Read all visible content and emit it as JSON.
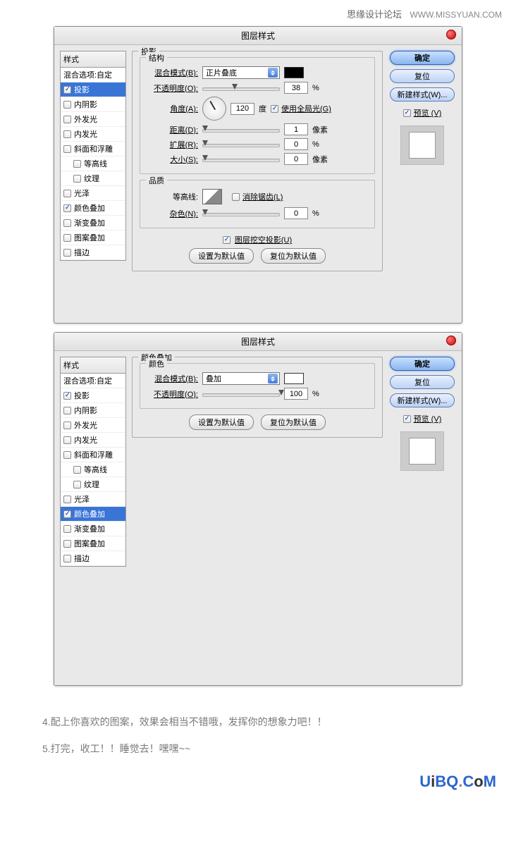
{
  "watermark": {
    "text1": "思缘设计论坛",
    "text2": "WWW.MISSYUAN.COM"
  },
  "dialog_title": "图层样式",
  "styles_header": "样式",
  "blend_options": "混合选项:自定",
  "style_items": [
    {
      "label": "投影",
      "checked": true
    },
    {
      "label": "内阴影",
      "checked": false
    },
    {
      "label": "外发光",
      "checked": false
    },
    {
      "label": "内发光",
      "checked": false
    },
    {
      "label": "斜面和浮雕",
      "checked": false
    },
    {
      "label": "等高线",
      "checked": false,
      "indent": true
    },
    {
      "label": "纹理",
      "checked": false,
      "indent": true
    },
    {
      "label": "光泽",
      "checked": false
    },
    {
      "label": "颜色叠加",
      "checked": true
    },
    {
      "label": "渐变叠加",
      "checked": false
    },
    {
      "label": "图案叠加",
      "checked": false
    },
    {
      "label": "描边",
      "checked": false
    }
  ],
  "panel1": {
    "title": "投影",
    "struct_title": "结构",
    "blend_mode_label": "混合模式(B):",
    "blend_mode_value": "正片叠底",
    "swatch_color": "#000000",
    "opacity_label": "不透明度(O):",
    "opacity_value": "38",
    "opacity_unit": "%",
    "angle_label": "角度(A):",
    "angle_value": "120",
    "angle_unit": "度",
    "global_light": "使用全局光(G)",
    "distance_label": "距离(D):",
    "distance_value": "1",
    "distance_unit": "像素",
    "spread_label": "扩展(R):",
    "spread_value": "0",
    "spread_unit": "%",
    "size_label": "大小(S):",
    "size_value": "0",
    "size_unit": "像素",
    "quality_title": "品质",
    "contour_label": "等高线:",
    "antialias": "消除锯齿(L)",
    "noise_label": "杂色(N):",
    "noise_value": "0",
    "noise_unit": "%",
    "knockout": "图层挖空投影(U)",
    "btn_defaults": "设置为默认值",
    "btn_reset": "复位为默认值"
  },
  "panel2": {
    "title": "颜色叠加",
    "color_title": "颜色",
    "blend_mode_label": "混合模式(B):",
    "blend_mode_value": "叠加",
    "swatch_color": "#ffffff",
    "opacity_label": "不透明度(O):",
    "opacity_value": "100",
    "opacity_unit": "%",
    "btn_defaults": "设置为默认值",
    "btn_reset": "复位为默认值"
  },
  "right": {
    "ok": "确定",
    "reset": "复位",
    "new_style": "新建样式(W)...",
    "preview": "预览 (V)"
  },
  "article": {
    "line1": "4.配上你喜欢的图案，效果会相当不错哦，发挥你的想象力吧！！",
    "line2": "5.打完，收工！！睡觉去！嘿嘿~~"
  },
  "logo": {
    "u": "U",
    "i": "i",
    "bq": "BQ",
    "dot": ".",
    "com": "C",
    "o": "o",
    "m": "M"
  }
}
